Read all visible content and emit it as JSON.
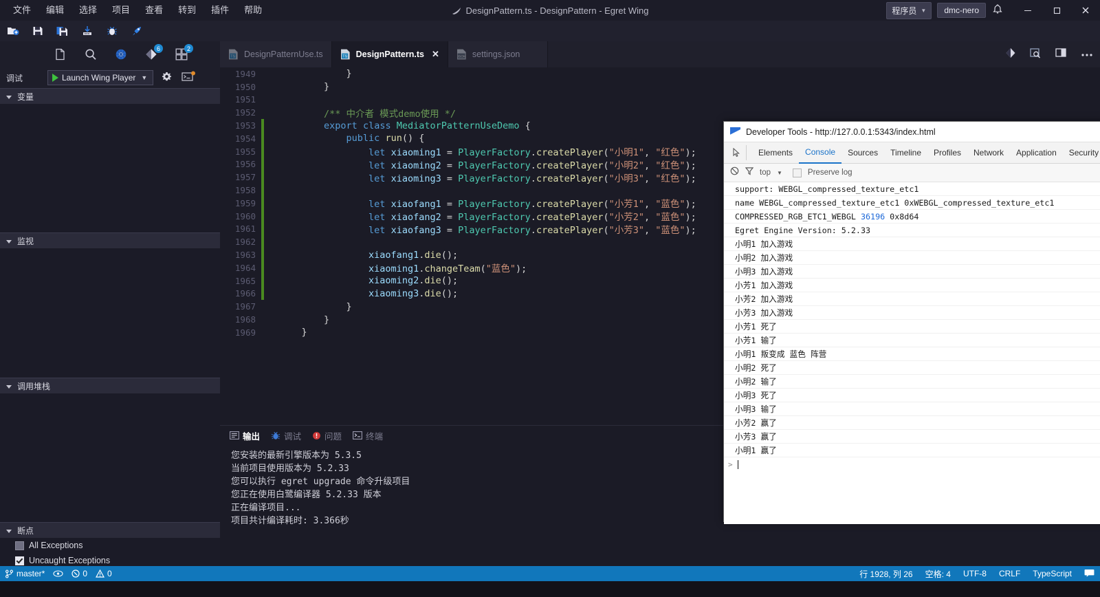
{
  "window": {
    "title": "DesignPattern.ts - DesignPattern - Egret Wing",
    "logo_icon": "egret-feather-icon",
    "minimize_icon": "minimize-icon",
    "maximize_icon": "maximize-icon",
    "close_icon": "close-icon",
    "role_label": "程序员",
    "role_caret": "▼",
    "user_label": "dmc-nero",
    "bell_icon": "bell-icon"
  },
  "menubar": {
    "items": [
      {
        "label": "文件",
        "name": "menu-file"
      },
      {
        "label": "编辑",
        "name": "menu-edit"
      },
      {
        "label": "选择",
        "name": "menu-select"
      },
      {
        "label": "项目",
        "name": "menu-project"
      },
      {
        "label": "查看",
        "name": "menu-view"
      },
      {
        "label": "转到",
        "name": "menu-goto"
      },
      {
        "label": "插件",
        "name": "menu-plugins"
      },
      {
        "label": "帮助",
        "name": "menu-help"
      }
    ]
  },
  "toolbar": {
    "icons": [
      {
        "name": "new-file-icon"
      },
      {
        "name": "save-icon"
      },
      {
        "name": "save-all-icon"
      },
      {
        "name": "publish-icon"
      },
      {
        "name": "bug-icon"
      },
      {
        "name": "rocket-run-icon"
      }
    ]
  },
  "activity_icons": [
    {
      "name": "explorer-icon",
      "badge": ""
    },
    {
      "name": "search-icon",
      "badge": ""
    },
    {
      "name": "debug-icon",
      "badge": ""
    },
    {
      "name": "source-control-icon",
      "badge": "6"
    },
    {
      "name": "extensions-icon",
      "badge": "2"
    }
  ],
  "debug_toolbar": {
    "label": "调试",
    "config_name": "Launch Wing Player",
    "caret": "▼",
    "play_icon": "play-icon",
    "gear_icon": "gear-icon",
    "terminal_icon": "open-console-icon"
  },
  "left_panel": {
    "sections": [
      {
        "title": "变量",
        "name": "section-variables"
      },
      {
        "title": "监视",
        "name": "section-watch"
      },
      {
        "title": "调用堆栈",
        "name": "section-callstack"
      },
      {
        "title": "断点",
        "name": "section-breakpoints"
      }
    ],
    "breakpoints": [
      {
        "label": "All Exceptions",
        "checked": false
      },
      {
        "label": "Uncaught Exceptions",
        "checked": true
      }
    ]
  },
  "editor_tabs": {
    "tabs": [
      {
        "label": "DesignPatternUse.ts",
        "active": false,
        "icon": "ts-file-icon",
        "closable": false
      },
      {
        "label": "DesignPattern.ts",
        "active": true,
        "icon": "ts-file-icon",
        "closable": true,
        "close_glyph": "✕"
      },
      {
        "label": "settings.json",
        "active": false,
        "icon": "json-file-icon",
        "closable": false
      }
    ],
    "right_icons": [
      {
        "name": "split-diff-icon"
      },
      {
        "name": "preview-icon"
      },
      {
        "name": "split-editor-icon"
      },
      {
        "name": "more-actions-icon"
      }
    ]
  },
  "editor": {
    "first_line_number": 1949,
    "lines": [
      {
        "n": 1949,
        "mark": false,
        "tokens": [
          {
            "t": "            }",
            "c": "p"
          }
        ]
      },
      {
        "n": 1950,
        "mark": false,
        "tokens": [
          {
            "t": "        }",
            "c": "p"
          }
        ]
      },
      {
        "n": 1951,
        "mark": false,
        "tokens": [
          {
            "t": "",
            "c": "p"
          }
        ]
      },
      {
        "n": 1952,
        "mark": false,
        "tokens": [
          {
            "t": "        /** 中介者 模式demo使用 */",
            "c": "cm"
          }
        ]
      },
      {
        "n": 1953,
        "mark": true,
        "tokens": [
          {
            "t": "        ",
            "c": "p"
          },
          {
            "t": "export",
            "c": "k"
          },
          {
            "t": " ",
            "c": "p"
          },
          {
            "t": "class",
            "c": "k"
          },
          {
            "t": " ",
            "c": "p"
          },
          {
            "t": "MediatorPatternUseDemo",
            "c": "cls"
          },
          {
            "t": " {",
            "c": "p"
          }
        ]
      },
      {
        "n": 1954,
        "mark": true,
        "tokens": [
          {
            "t": "            ",
            "c": "p"
          },
          {
            "t": "public",
            "c": "k"
          },
          {
            "t": " ",
            "c": "p"
          },
          {
            "t": "run",
            "c": "fn"
          },
          {
            "t": "() {",
            "c": "p"
          }
        ]
      },
      {
        "n": 1955,
        "mark": true,
        "tokens": [
          {
            "t": "                ",
            "c": "p"
          },
          {
            "t": "let",
            "c": "k"
          },
          {
            "t": " ",
            "c": "p"
          },
          {
            "t": "xiaoming1",
            "c": "v"
          },
          {
            "t": " = ",
            "c": "p"
          },
          {
            "t": "PlayerFactory",
            "c": "cls"
          },
          {
            "t": ".",
            "c": "p"
          },
          {
            "t": "createPlayer",
            "c": "fn"
          },
          {
            "t": "(",
            "c": "p"
          },
          {
            "t": "\"小明1\"",
            "c": "str"
          },
          {
            "t": ", ",
            "c": "p"
          },
          {
            "t": "\"红色\"",
            "c": "str"
          },
          {
            "t": ");",
            "c": "p"
          }
        ]
      },
      {
        "n": 1956,
        "mark": true,
        "tokens": [
          {
            "t": "                ",
            "c": "p"
          },
          {
            "t": "let",
            "c": "k"
          },
          {
            "t": " ",
            "c": "p"
          },
          {
            "t": "xiaoming2",
            "c": "v"
          },
          {
            "t": " = ",
            "c": "p"
          },
          {
            "t": "PlayerFactory",
            "c": "cls"
          },
          {
            "t": ".",
            "c": "p"
          },
          {
            "t": "createPlayer",
            "c": "fn"
          },
          {
            "t": "(",
            "c": "p"
          },
          {
            "t": "\"小明2\"",
            "c": "str"
          },
          {
            "t": ", ",
            "c": "p"
          },
          {
            "t": "\"红色\"",
            "c": "str"
          },
          {
            "t": ");",
            "c": "p"
          }
        ]
      },
      {
        "n": 1957,
        "mark": true,
        "tokens": [
          {
            "t": "                ",
            "c": "p"
          },
          {
            "t": "let",
            "c": "k"
          },
          {
            "t": " ",
            "c": "p"
          },
          {
            "t": "xiaoming3",
            "c": "v"
          },
          {
            "t": " = ",
            "c": "p"
          },
          {
            "t": "PlayerFactory",
            "c": "cls"
          },
          {
            "t": ".",
            "c": "p"
          },
          {
            "t": "createPlayer",
            "c": "fn"
          },
          {
            "t": "(",
            "c": "p"
          },
          {
            "t": "\"小明3\"",
            "c": "str"
          },
          {
            "t": ", ",
            "c": "p"
          },
          {
            "t": "\"红色\"",
            "c": "str"
          },
          {
            "t": ");",
            "c": "p"
          }
        ]
      },
      {
        "n": 1958,
        "mark": true,
        "tokens": [
          {
            "t": "",
            "c": "p"
          }
        ]
      },
      {
        "n": 1959,
        "mark": true,
        "tokens": [
          {
            "t": "                ",
            "c": "p"
          },
          {
            "t": "let",
            "c": "k"
          },
          {
            "t": " ",
            "c": "p"
          },
          {
            "t": "xiaofang1",
            "c": "v"
          },
          {
            "t": " = ",
            "c": "p"
          },
          {
            "t": "PlayerFactory",
            "c": "cls"
          },
          {
            "t": ".",
            "c": "p"
          },
          {
            "t": "createPlayer",
            "c": "fn"
          },
          {
            "t": "(",
            "c": "p"
          },
          {
            "t": "\"小芳1\"",
            "c": "str"
          },
          {
            "t": ", ",
            "c": "p"
          },
          {
            "t": "\"蓝色\"",
            "c": "str"
          },
          {
            "t": ");",
            "c": "p"
          }
        ]
      },
      {
        "n": 1960,
        "mark": true,
        "tokens": [
          {
            "t": "                ",
            "c": "p"
          },
          {
            "t": "let",
            "c": "k"
          },
          {
            "t": " ",
            "c": "p"
          },
          {
            "t": "xiaofang2",
            "c": "v"
          },
          {
            "t": " = ",
            "c": "p"
          },
          {
            "t": "PlayerFactory",
            "c": "cls"
          },
          {
            "t": ".",
            "c": "p"
          },
          {
            "t": "createPlayer",
            "c": "fn"
          },
          {
            "t": "(",
            "c": "p"
          },
          {
            "t": "\"小芳2\"",
            "c": "str"
          },
          {
            "t": ", ",
            "c": "p"
          },
          {
            "t": "\"蓝色\"",
            "c": "str"
          },
          {
            "t": ");",
            "c": "p"
          }
        ]
      },
      {
        "n": 1961,
        "mark": true,
        "tokens": [
          {
            "t": "                ",
            "c": "p"
          },
          {
            "t": "let",
            "c": "k"
          },
          {
            "t": " ",
            "c": "p"
          },
          {
            "t": "xiaofang3",
            "c": "v"
          },
          {
            "t": " = ",
            "c": "p"
          },
          {
            "t": "PlayerFactory",
            "c": "cls"
          },
          {
            "t": ".",
            "c": "p"
          },
          {
            "t": "createPlayer",
            "c": "fn"
          },
          {
            "t": "(",
            "c": "p"
          },
          {
            "t": "\"小芳3\"",
            "c": "str"
          },
          {
            "t": ", ",
            "c": "p"
          },
          {
            "t": "\"蓝色\"",
            "c": "str"
          },
          {
            "t": ");",
            "c": "p"
          }
        ]
      },
      {
        "n": 1962,
        "mark": true,
        "tokens": [
          {
            "t": "",
            "c": "p"
          }
        ]
      },
      {
        "n": 1963,
        "mark": true,
        "tokens": [
          {
            "t": "                ",
            "c": "p"
          },
          {
            "t": "xiaofang1",
            "c": "v"
          },
          {
            "t": ".",
            "c": "p"
          },
          {
            "t": "die",
            "c": "fn"
          },
          {
            "t": "();",
            "c": "p"
          }
        ]
      },
      {
        "n": 1964,
        "mark": true,
        "tokens": [
          {
            "t": "                ",
            "c": "p"
          },
          {
            "t": "xiaoming1",
            "c": "v"
          },
          {
            "t": ".",
            "c": "p"
          },
          {
            "t": "changeTeam",
            "c": "fn"
          },
          {
            "t": "(",
            "c": "p"
          },
          {
            "t": "\"蓝色\"",
            "c": "str"
          },
          {
            "t": ");",
            "c": "p"
          }
        ]
      },
      {
        "n": 1965,
        "mark": true,
        "tokens": [
          {
            "t": "                ",
            "c": "p"
          },
          {
            "t": "xiaoming2",
            "c": "v"
          },
          {
            "t": ".",
            "c": "p"
          },
          {
            "t": "die",
            "c": "fn"
          },
          {
            "t": "();",
            "c": "p"
          }
        ]
      },
      {
        "n": 1966,
        "mark": true,
        "tokens": [
          {
            "t": "                ",
            "c": "p"
          },
          {
            "t": "xiaoming3",
            "c": "v"
          },
          {
            "t": ".",
            "c": "p"
          },
          {
            "t": "die",
            "c": "fn"
          },
          {
            "t": "();",
            "c": "p"
          }
        ]
      },
      {
        "n": 1967,
        "mark": false,
        "tokens": [
          {
            "t": "            }",
            "c": "p"
          }
        ]
      },
      {
        "n": 1968,
        "mark": false,
        "tokens": [
          {
            "t": "        }",
            "c": "p"
          }
        ]
      },
      {
        "n": 1969,
        "mark": false,
        "tokens": [
          {
            "t": "    }",
            "c": "p"
          }
        ]
      }
    ]
  },
  "bottom_panel": {
    "tabs": [
      {
        "label": "输出",
        "active": true,
        "icon": "output-icon"
      },
      {
        "label": "调试",
        "active": false,
        "icon": "debug-console-icon"
      },
      {
        "label": "问题",
        "active": false,
        "icon": "problems-icon"
      },
      {
        "label": "终端",
        "active": false,
        "icon": "terminal-icon"
      }
    ],
    "output_lines": [
      "您安装的最新引擎版本为 5.3.5",
      "当前项目使用版本为 5.2.33",
      "您可以执行 egret upgrade 命令升级项目",
      "您正在使用白鹭编译器 5.2.33 版本",
      "正在编译项目...",
      "项目共计编译耗时: 3.366秒"
    ]
  },
  "devtools": {
    "title": "Developer Tools - http://127.0.0.1:5343/index.html",
    "logo_icon": "chrome-devtools-icon",
    "inspect_icon": "inspect-element-icon",
    "tabs": [
      {
        "label": "Elements",
        "active": false
      },
      {
        "label": "Console",
        "active": true
      },
      {
        "label": "Sources",
        "active": false
      },
      {
        "label": "Timeline",
        "active": false
      },
      {
        "label": "Profiles",
        "active": false
      },
      {
        "label": "Network",
        "active": false
      },
      {
        "label": "Application",
        "active": false
      },
      {
        "label": "Security",
        "active": false
      }
    ],
    "filterbar": {
      "clear_icon": "clear-console-icon",
      "filter_icon": "filter-icon",
      "context_label": "top",
      "context_caret": "▼",
      "preserve_checkbox": false,
      "preserve_label": "Preserve log"
    },
    "console_rows": [
      {
        "text": "support: WEBGL_compressed_texture_etc1"
      },
      {
        "text": "name WEBGL_compressed_texture_etc1 0xWEBGL_compressed_texture_etc1"
      },
      {
        "text": "COMPRESSED_RGB_ETC1_WEBGL ",
        "num": "36196",
        "tail": " 0x8d64"
      },
      {
        "text": "Egret Engine Version: 5.2.33"
      },
      {
        "text": "小明1 加入游戏"
      },
      {
        "text": "小明2 加入游戏"
      },
      {
        "text": "小明3 加入游戏"
      },
      {
        "text": "小芳1 加入游戏"
      },
      {
        "text": "小芳2 加入游戏"
      },
      {
        "text": "小芳3 加入游戏"
      },
      {
        "text": "小芳1 死了"
      },
      {
        "text": "小芳1 输了"
      },
      {
        "text": "小明1 叛变成 蓝色 阵营"
      },
      {
        "text": "小明2 死了"
      },
      {
        "text": "小明2 输了"
      },
      {
        "text": "小明3 死了"
      },
      {
        "text": "小明3 输了"
      },
      {
        "text": "小芳2 赢了"
      },
      {
        "text": "小芳3 赢了"
      },
      {
        "text": "小明1 赢了"
      }
    ],
    "prompt_arrow": ">"
  },
  "statusbar": {
    "branch_icon": "source-control-branch-icon",
    "branch_label": "master*",
    "sync_icon": "sync-icon",
    "error_icon": "error-icon",
    "error_count": "0",
    "warning_icon": "warning-icon",
    "warning_count": "0",
    "cursor_position": "行 1928, 列 26",
    "indent": "空格: 4",
    "encoding": "UTF-8",
    "eol": "CRLF",
    "language": "TypeScript",
    "feedback_icon": "feedback-icon"
  },
  "colors": {
    "accent": "#1177bb",
    "titlebar_bg": "#1c1c28",
    "editor_bg": "#1b1b26",
    "panel_bg": "#1b1b27",
    "keyword": "#569cd6",
    "class": "#4ec9b0",
    "string": "#ce9178",
    "comment": "#6a9955",
    "function": "#dcdcaa",
    "variable": "#9cdcfe",
    "gutter_mark": "#4a8a20",
    "badge_blue": "#1f8ad2",
    "devtools_tab_active": "#1a73c9"
  }
}
